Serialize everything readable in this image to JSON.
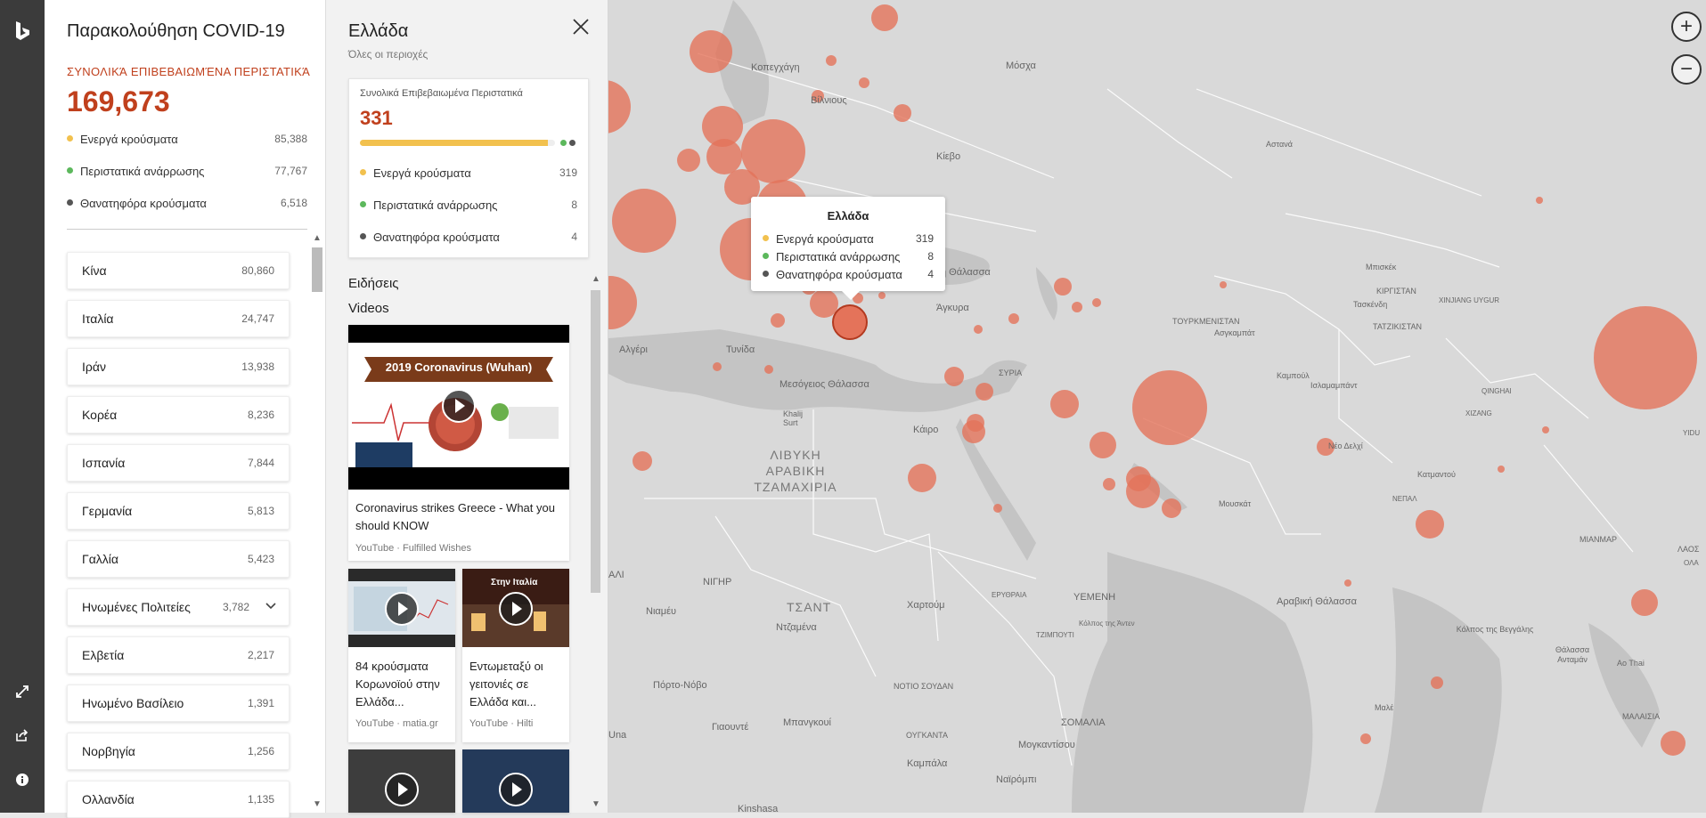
{
  "left_panel": {
    "title": "Παρακολούθηση COVID-19",
    "total_label": "ΣΥΝΟΛΙΚΆ ΕΠΙΒΕΒΑΙΩΜΈΝΑ ΠΕΡΙΣΤΑΤΙΚΆ",
    "total_value": "169,673",
    "stats": [
      {
        "label": "Ενεργά κρούσματα",
        "value": "85,388",
        "color": "#f2c14e"
      },
      {
        "label": "Περιστατικά ανάρρωσης",
        "value": "77,767",
        "color": "#5cb85c"
      },
      {
        "label": "Θανατηφόρα κρούσματα",
        "value": "6,518",
        "color": "#555555"
      }
    ],
    "countries": [
      {
        "name": "Κίνα",
        "count": "80,860"
      },
      {
        "name": "Ιταλία",
        "count": "24,747"
      },
      {
        "name": "Ιράν",
        "count": "13,938"
      },
      {
        "name": "Κορέα",
        "count": "8,236"
      },
      {
        "name": "Ισπανία",
        "count": "7,844"
      },
      {
        "name": "Γερμανία",
        "count": "5,813"
      },
      {
        "name": "Γαλλία",
        "count": "5,423"
      },
      {
        "name": "Ηνωμένες Πολιτείες",
        "count": "3,782"
      },
      {
        "name": "Ελβετία",
        "count": "2,217"
      },
      {
        "name": "Ηνωμένο Βασίλειο",
        "count": "1,391"
      },
      {
        "name": "Νορβηγία",
        "count": "1,256"
      },
      {
        "name": "Ολλανδία",
        "count": "1,135"
      }
    ]
  },
  "detail_panel": {
    "title": "Ελλάδα",
    "subtitle": "Όλες οι περιοχές",
    "card_label": "Συνολικά Επιβεβαιωμένα Περιστατικά",
    "card_total": "331",
    "active_fraction": 0.964,
    "stats": [
      {
        "label": "Ενεργά κρούσματα",
        "value": "319",
        "color": "#f2c14e"
      },
      {
        "label": "Περιστατικά ανάρρωσης",
        "value": "8",
        "color": "#5cb85c"
      },
      {
        "label": "Θανατηφόρα κρούσματα",
        "value": "4",
        "color": "#555555"
      }
    ],
    "news_heading": "Ειδήσεις",
    "videos_heading": "Videos",
    "videos": [
      {
        "thumb_text": "2019 Coronavirus (Wuhan)",
        "title": "Coronavirus strikes Greece - What you should KNOW",
        "source": "YouTube · Fulfilled Wishes"
      },
      {
        "title": "84 κρούσματα Κορωνοϊού στην Ελλάδα...",
        "source": "YouTube · matia.gr"
      },
      {
        "thumb_text": "Στην Ιταλία",
        "title": "Εντωμεταξύ οι γειτονιές σε Ελλάδα και...",
        "source": "YouTube · Hilti"
      }
    ]
  },
  "tooltip": {
    "title": "Ελλάδα",
    "rows": [
      {
        "label": "Ενεργά κρούσματα",
        "value": "319",
        "color": "#f2c14e"
      },
      {
        "label": "Περιστατικά ανάρρωσης",
        "value": "8",
        "color": "#5cb85c"
      },
      {
        "label": "Θανατηφόρα κρούσματα",
        "value": "4",
        "color": "#555555"
      }
    ]
  },
  "map_labels": {
    "kopenhagen": "Κοπεγχάγη",
    "moscow": "Μόσχα",
    "vilnius": "Βίλνιους",
    "kiev": "Κίεβο",
    "astana": "Αστανά",
    "black_sea": "ή Θάλασσα",
    "bishkek": "Μπισκέκ",
    "kyrgyzstan": "ΚΙΡΓΙΣΤΑΝ",
    "ankara": "Άγκυρα",
    "tashkent": "Τασκένδη",
    "turkmenistan": "ΤΟΥΡΚΜΕΝΙΣΤΑΝ",
    "tajikistan": "ΤΑΤΖΙΚΙΣΤΑΝ",
    "xinjiang": "XINJIANG UYGUR",
    "ashgabat": "Ασγκαμπάτ",
    "algiers": "Αλγέρι",
    "tunis": "Τυνίδα",
    "syria": "ΣΥΡΙΑ",
    "kabul": "Καμπούλ",
    "islamabad": "Ισλαμαμπάντ",
    "qinghai": "QINGHAI",
    "med": "Μεσόγειος Θάλασσα",
    "sirte": "Khalij Surt",
    "xizang": "XIZANG",
    "cairo": "Κάιρο",
    "new_delhi": "Νέο Δελχί",
    "libya": "ΛΙΒΥΚΗ ΑΡΑΒΙΚΗ ΤΖΑΜΑΧΙΡΙΑ",
    "kathmandu": "Κατμαντού",
    "nepal": "ΝΕΠΑΛ",
    "muscat": "Μουσκάτ",
    "myanmar": "ΜΙΑΝΜΑΡ",
    "laos": "ΛΑΟΣ",
    "niger": "ΝΙΓΗΡ",
    "chad": "ΤΣΑΝΤ",
    "yemen": "ΥΕΜΕΝΗ",
    "arabian_sea": "Αραβική Θάλασσα",
    "eritrea": "ΕΡΥΘΡΑΙΑ",
    "khartoum": "Χαρτούμ",
    "aden": "Κόλπος της Άντεν",
    "djibouti": "ΤΖΙΜΠΟΥΤΙ",
    "bengal": "Κόλπος της Βεγγάλης",
    "andaman": "Θάλασσα Ανταμάν",
    "niamey": "Νιαμέυ",
    "ndjamena": "Ντζαμένα",
    "porto_novo": "Πόρτο-Νόβο",
    "south_sudan": "ΝΟΤΙΟ ΣΟΥΔΑΝ",
    "male": "Μαλέ",
    "yaounde": "Γιαουντέ",
    "bangui": "Μπανγκουί",
    "somalia": "ΣΟΜΑΛΙΑ",
    "uganda": "ΟΥΓΚΑΝΤΑ",
    "mogadishu": "Μογκαντίσου",
    "malaysia": "ΜΑΛΑΙΣΙΑ",
    "kampala": "Καμπάλα",
    "nairobi": "Ναϊρόμπι",
    "kinshasa": "Kinshasa",
    "ao_thai": "Ao Thai",
    "yidu": "YIDU",
    "lali": "ΑΛΙ",
    "una": "Una",
    "ola": "ΟΛΑ"
  },
  "colors": {
    "accent": "#c0401d",
    "bubble": "#e4735a",
    "active": "#f2c14e",
    "recovered": "#5cb85c",
    "deaths": "#555555",
    "rail": "#3b3b3b"
  },
  "icons": [
    "bing-logo-icon",
    "expand-icon",
    "share-icon",
    "info-icon",
    "close-icon",
    "zoom-in-icon",
    "zoom-out-icon",
    "play-icon",
    "chevron-down-icon"
  ]
}
